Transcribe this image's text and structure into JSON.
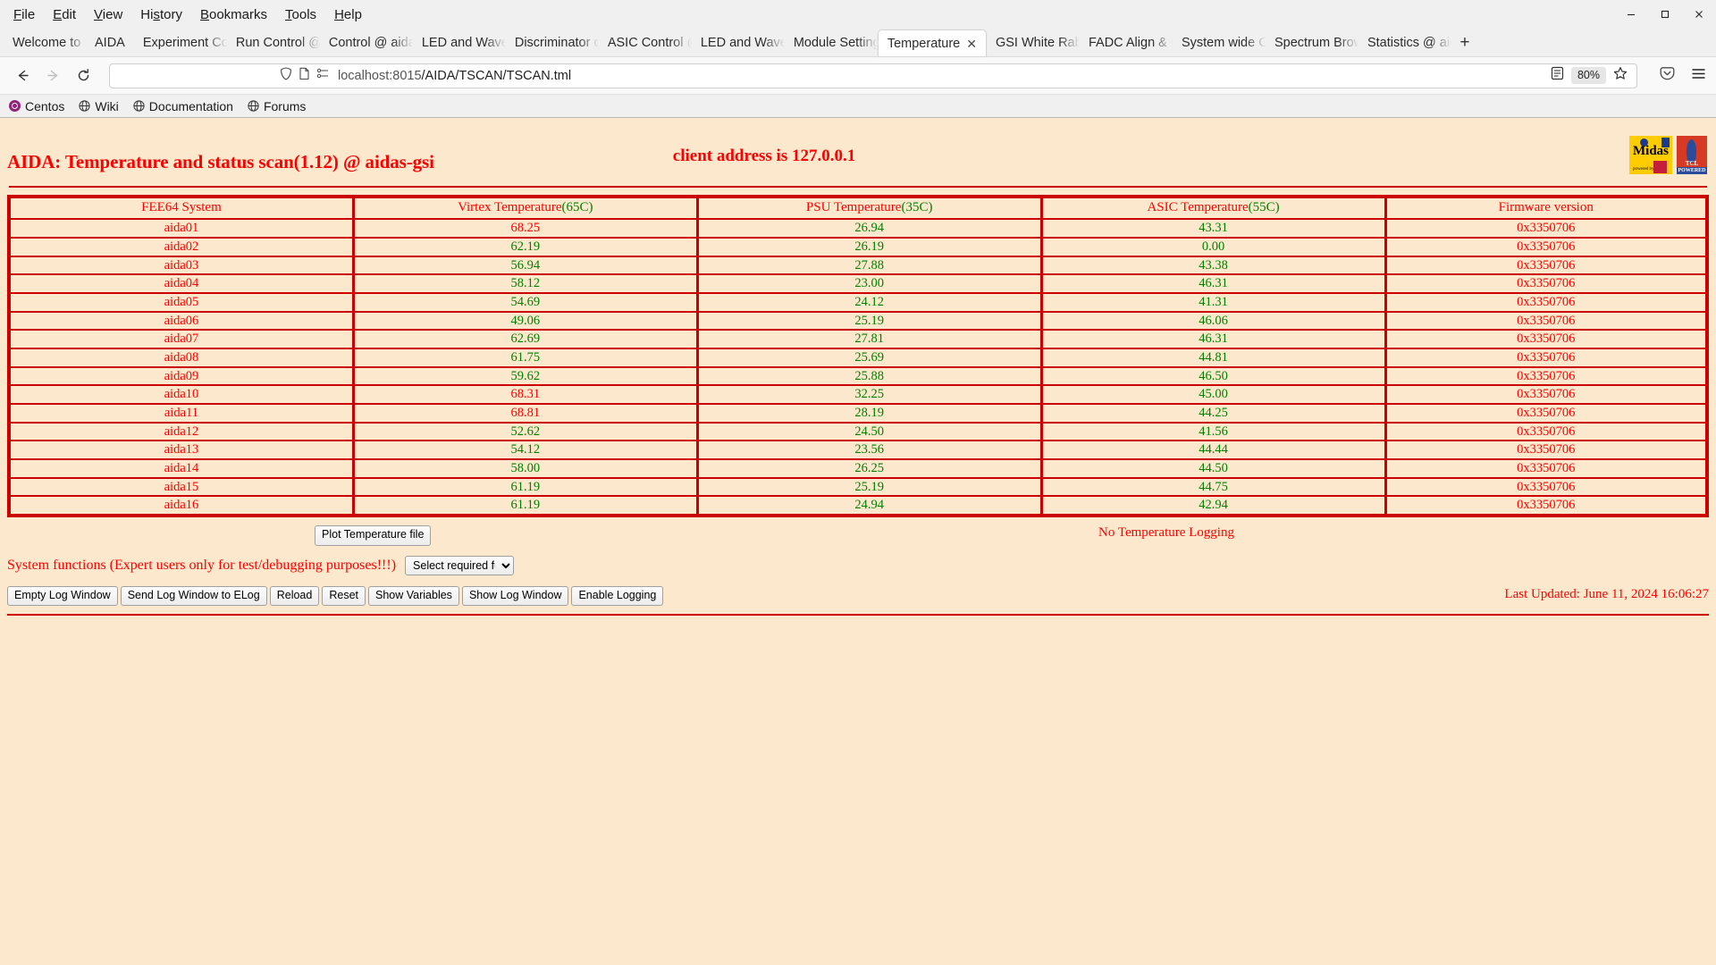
{
  "browser": {
    "menus": [
      "File",
      "Edit",
      "View",
      "History",
      "Bookmarks",
      "Tools",
      "Help"
    ],
    "window_controls": {
      "minimize": "minimize-icon",
      "maximize": "maximize-icon",
      "close": "close-icon"
    },
    "tabs": [
      {
        "label": "Welcome to Centos",
        "active": false
      },
      {
        "label": "AIDA",
        "active": false,
        "narrow": true
      },
      {
        "label": "Experiment Control",
        "active": false
      },
      {
        "label": "Run Control @ aidas",
        "active": false
      },
      {
        "label": "Control @ aidas",
        "active": false
      },
      {
        "label": "LED and Waveform",
        "active": false
      },
      {
        "label": "Discriminator config",
        "active": false
      },
      {
        "label": "ASIC Control @ aidas",
        "active": false
      },
      {
        "label": "LED and Waveform",
        "active": false
      },
      {
        "label": "Module Settings",
        "active": false
      },
      {
        "label": "Temperature",
        "active": true
      },
      {
        "label": "GSI White Rabbit",
        "active": false
      },
      {
        "label": "FADC Align & Check",
        "active": false
      },
      {
        "label": "System wide Controls",
        "active": false
      },
      {
        "label": "Spectrum Browser",
        "active": false
      },
      {
        "label": "Statistics @ aidas",
        "active": false
      }
    ],
    "new_tab_label": "+",
    "url_host": "localhost:8015",
    "url_path": "/AIDA/TSCAN/TSCAN.tml",
    "zoom_level": "80%",
    "bookmarks": [
      {
        "label": "Centos",
        "icon": "centos-icon"
      },
      {
        "label": "Wiki",
        "icon": "globe-icon"
      },
      {
        "label": "Documentation",
        "icon": "globe-icon"
      },
      {
        "label": "Forums",
        "icon": "globe-icon"
      }
    ]
  },
  "page": {
    "title": "AIDA: Temperature and status scan(1.12) @ aidas-gsi",
    "client_address": "client address is 127.0.0.1",
    "logos": {
      "midas": {
        "name": "Midas",
        "sub": "powered by"
      },
      "tcl": {
        "name": "TCL",
        "sub": "POWERED"
      }
    },
    "table": {
      "headers": [
        {
          "text": "FEE64 System",
          "threshold": ""
        },
        {
          "text": "Virtex Temperature",
          "threshold": "(65C)"
        },
        {
          "text": "PSU Temperature",
          "threshold": "(35C)"
        },
        {
          "text": "ASIC Temperature",
          "threshold": "(55C)"
        },
        {
          "text": "Firmware version",
          "threshold": ""
        }
      ],
      "rows": [
        {
          "system": "aida01",
          "virtex": "68.25",
          "virtex_color": "red",
          "psu": "26.94",
          "psu_color": "green",
          "asic": "43.31",
          "asic_color": "green",
          "firmware": "0x3350706"
        },
        {
          "system": "aida02",
          "virtex": "62.19",
          "virtex_color": "green",
          "psu": "26.19",
          "psu_color": "green",
          "asic": "0.00",
          "asic_color": "green",
          "firmware": "0x3350706"
        },
        {
          "system": "aida03",
          "virtex": "56.94",
          "virtex_color": "green",
          "psu": "27.88",
          "psu_color": "green",
          "asic": "43.38",
          "asic_color": "green",
          "firmware": "0x3350706"
        },
        {
          "system": "aida04",
          "virtex": "58.12",
          "virtex_color": "green",
          "psu": "23.00",
          "psu_color": "green",
          "asic": "46.31",
          "asic_color": "green",
          "firmware": "0x3350706"
        },
        {
          "system": "aida05",
          "virtex": "54.69",
          "virtex_color": "green",
          "psu": "24.12",
          "psu_color": "green",
          "asic": "41.31",
          "asic_color": "green",
          "firmware": "0x3350706"
        },
        {
          "system": "aida06",
          "virtex": "49.06",
          "virtex_color": "green",
          "psu": "25.19",
          "psu_color": "green",
          "asic": "46.06",
          "asic_color": "green",
          "firmware": "0x3350706"
        },
        {
          "system": "aida07",
          "virtex": "62.69",
          "virtex_color": "green",
          "psu": "27.81",
          "psu_color": "green",
          "asic": "46.31",
          "asic_color": "green",
          "firmware": "0x3350706"
        },
        {
          "system": "aida08",
          "virtex": "61.75",
          "virtex_color": "green",
          "psu": "25.69",
          "psu_color": "green",
          "asic": "44.81",
          "asic_color": "green",
          "firmware": "0x3350706"
        },
        {
          "system": "aida09",
          "virtex": "59.62",
          "virtex_color": "green",
          "psu": "25.88",
          "psu_color": "green",
          "asic": "46.50",
          "asic_color": "green",
          "firmware": "0x3350706"
        },
        {
          "system": "aida10",
          "virtex": "68.31",
          "virtex_color": "red",
          "psu": "32.25",
          "psu_color": "green",
          "asic": "45.00",
          "asic_color": "green",
          "firmware": "0x3350706"
        },
        {
          "system": "aida11",
          "virtex": "68.81",
          "virtex_color": "red",
          "psu": "28.19",
          "psu_color": "green",
          "asic": "44.25",
          "asic_color": "green",
          "firmware": "0x3350706"
        },
        {
          "system": "aida12",
          "virtex": "52.62",
          "virtex_color": "green",
          "psu": "24.50",
          "psu_color": "green",
          "asic": "41.56",
          "asic_color": "green",
          "firmware": "0x3350706"
        },
        {
          "system": "aida13",
          "virtex": "54.12",
          "virtex_color": "green",
          "psu": "23.56",
          "psu_color": "green",
          "asic": "44.44",
          "asic_color": "green",
          "firmware": "0x3350706"
        },
        {
          "system": "aida14",
          "virtex": "58.00",
          "virtex_color": "green",
          "psu": "26.25",
          "psu_color": "green",
          "asic": "44.50",
          "asic_color": "green",
          "firmware": "0x3350706"
        },
        {
          "system": "aida15",
          "virtex": "61.19",
          "virtex_color": "green",
          "psu": "25.19",
          "psu_color": "green",
          "asic": "44.75",
          "asic_color": "green",
          "firmware": "0x3350706"
        },
        {
          "system": "aida16",
          "virtex": "61.19",
          "virtex_color": "green",
          "psu": "24.94",
          "psu_color": "green",
          "asic": "42.94",
          "asic_color": "green",
          "firmware": "0x3350706"
        }
      ]
    },
    "controls": {
      "plot_button": "Plot Temperature file",
      "logging_status": "No Temperature Logging",
      "system_functions_label": "System functions (Expert users only for test/debugging purposes!!!)",
      "system_functions_selected": "Select required function",
      "system_functions_options": [
        "Select required function"
      ],
      "buttons": [
        "Empty Log Window",
        "Send Log Window to ELog",
        "Reload",
        "Reset",
        "Show Variables",
        "Show Log Window",
        "Enable Logging"
      ]
    },
    "last_updated": "Last Updated: June 11, 2024 16:06:27",
    "colors": {
      "background": "#FCE8CC",
      "red": "#FF0000",
      "green": "#008000",
      "border": "#CC0000"
    }
  }
}
